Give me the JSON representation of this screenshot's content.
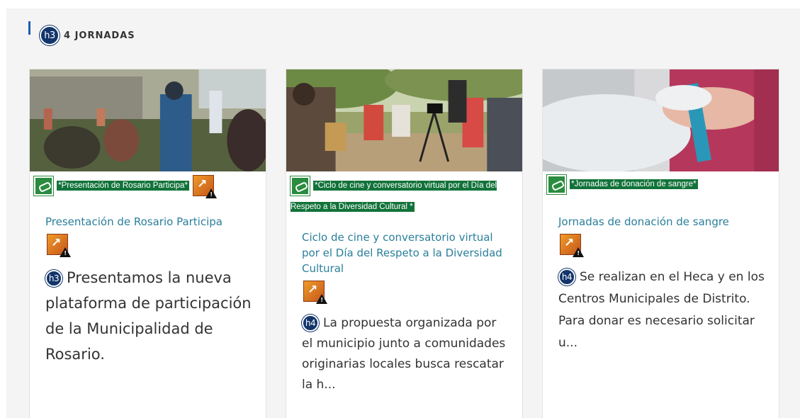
{
  "section": {
    "heading_badge": "h3",
    "title": "4 JORNADAS"
  },
  "cards": [
    {
      "image_alt": "*Presentación de Rosario Participa*",
      "title": "Presentación de Rosario Participa",
      "desc_badge": "h3",
      "description": "Presentamos la nueva plataforma de participación de la Municipalidad de Rosario."
    },
    {
      "image_alt": "*Ciclo de cine y conversatorio virtual por el Día del Respeto a la Diversidad Cultural *",
      "title": "Ciclo de cine y conversatorio virtual por el Día del Respeto a la Diversidad Cultural",
      "desc_badge": "h4",
      "description": "La propuesta organizada por el municipio junto a comunidades originarias locales busca rescatar la h..."
    },
    {
      "image_alt": "*Jornadas de donación de sangre*",
      "title": "Jornadas de donación de sangre",
      "desc_badge": "h4",
      "description": "Se realizan en el Heca y en los Centros Municipales de Distrito. Para donar es necesario solicitar u..."
    }
  ],
  "icons": {
    "image_link": "chain-link-icon",
    "external_warning": "external-link-warning-icon"
  },
  "colors": {
    "accent_bar": "#1a5fb4",
    "badge": "#12356b",
    "link_title": "#2a7f9b",
    "alt_highlight": "#12733a",
    "warning_orange": "#e8862a"
  }
}
